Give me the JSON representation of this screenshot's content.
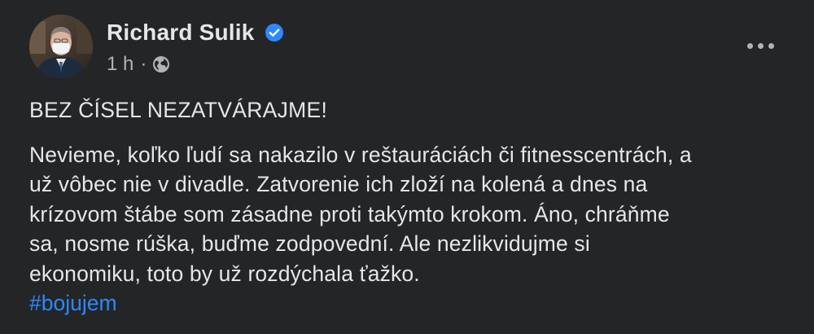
{
  "post": {
    "author": {
      "name": "Richard Sulik",
      "verified": true,
      "avatar_icon": "profile-photo"
    },
    "timestamp": "1 h",
    "separator": "·",
    "audience_icon": "globe-icon",
    "more_icon": "ellipsis-horizontal-icon",
    "headline": "BEZ ČÍSEL NEZATVÁRAJME!",
    "body": "Nevieme, koľko ľudí sa nakazilo v reštauráciách či fitnesscentrách, a\nuž vôbec nie v divadle. Zatvorenie ich zloží na kolená a dnes na\nkrízovom štábe som zásadne proti takýmto krokom. Áno, chráňme\nsa, nosme rúška, buďme zodpovední. Ale nezlikvidujme si\nekonomiku, toto by už rozdýchala ťažko.",
    "hashtag": "#bojujem"
  },
  "colors": {
    "background": "#242526",
    "primary_text": "#e4e6eb",
    "secondary_text": "#b0b3b8",
    "link": "#2d88ff",
    "verified_badge": "#2d88ff"
  }
}
